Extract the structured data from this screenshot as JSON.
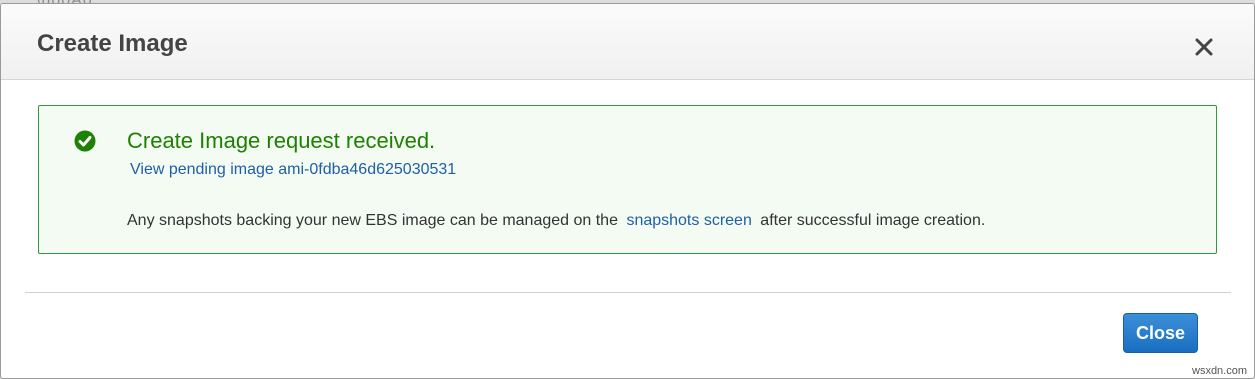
{
  "modal": {
    "title": "Create Image",
    "close_icon": "close-x-icon"
  },
  "alert": {
    "icon": "check-circle-icon",
    "title": "Create Image request received.",
    "pending_link": "View pending image ami-0fdba46d625030531",
    "note_before": "Any snapshots backing your new EBS image can be managed on the",
    "note_link": "snapshots screen",
    "note_after": "after successful image creation."
  },
  "footer": {
    "close_label": "Close"
  },
  "watermark": "wsxdn.com",
  "colors": {
    "success": "#1d8102",
    "link": "#1f5fa8",
    "primary_button": "#1a6ec0",
    "alert_bg": "#f3fbf3",
    "alert_border": "#2e9a3a"
  }
}
